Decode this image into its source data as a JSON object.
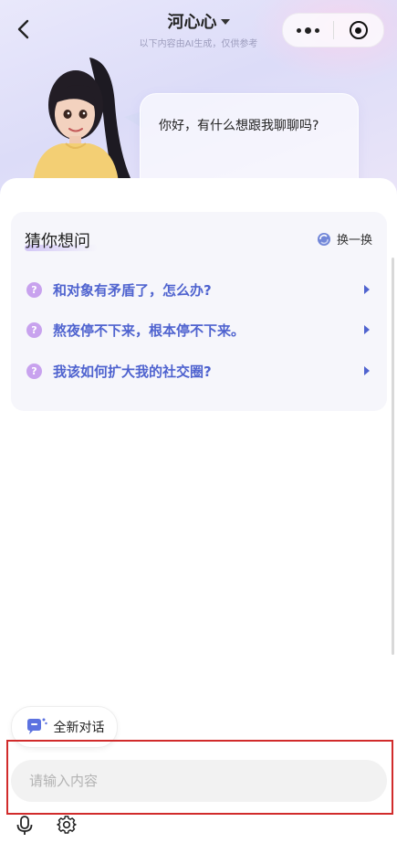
{
  "header": {
    "title": "河心心",
    "subtitle": "以下内容由AI生成，仅供参考"
  },
  "greeting": "你好，有什么想跟我聊聊吗?",
  "suggestions": {
    "title": "猜你想问",
    "refresh_label": "换一换",
    "items": [
      {
        "mark": "?",
        "text": "和对象有矛盾了，怎么办?"
      },
      {
        "mark": "?",
        "text": "熬夜停不下来，根本停不下来。"
      },
      {
        "mark": "?",
        "text": "我该如何扩大我的社交圈?"
      }
    ]
  },
  "new_chat_label": "全新对话",
  "input": {
    "placeholder": "请输入内容"
  },
  "colors": {
    "accent": "#4f63cf",
    "question_mark": "#c8a2ee",
    "highlight_frame": "#d12b2b"
  },
  "icons": [
    "back-arrow-icon",
    "caret-down-icon",
    "more-dots-icon",
    "target-icon",
    "refresh-icon",
    "question-mark-icon",
    "triangle-right-icon",
    "chat-bubble-icon",
    "microphone-icon",
    "gear-icon"
  ]
}
